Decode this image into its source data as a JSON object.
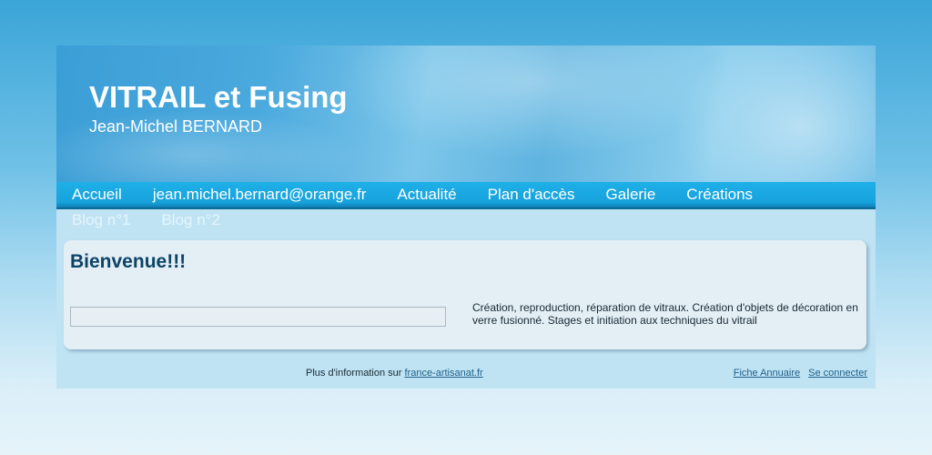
{
  "header": {
    "title": "VITRAIL et Fusing",
    "subtitle": "Jean-Michel BERNARD"
  },
  "nav": {
    "row1": [
      "Accueil",
      "jean.michel.bernard@orange.fr",
      "Actualité",
      "Plan d'accès",
      "Galerie",
      "Créations"
    ],
    "row2": [
      "Blog n°1",
      "Blog n°2"
    ]
  },
  "content": {
    "heading": "Bienvenue!!!",
    "description": "Création, reproduction, réparation de vitraux. Création d'objets de décoration en verre fusionné. Stages et initiation aux techniques du vitrail"
  },
  "footer": {
    "info_prefix": "Plus d'information sur ",
    "info_link": "france-artisanat.fr",
    "link_directory": "Fiche Annuaire",
    "link_login": "Se connecter"
  },
  "colors": {
    "nav_bar": "#17a2dc",
    "heading": "#0d4466",
    "link": "#1f5f8a"
  }
}
